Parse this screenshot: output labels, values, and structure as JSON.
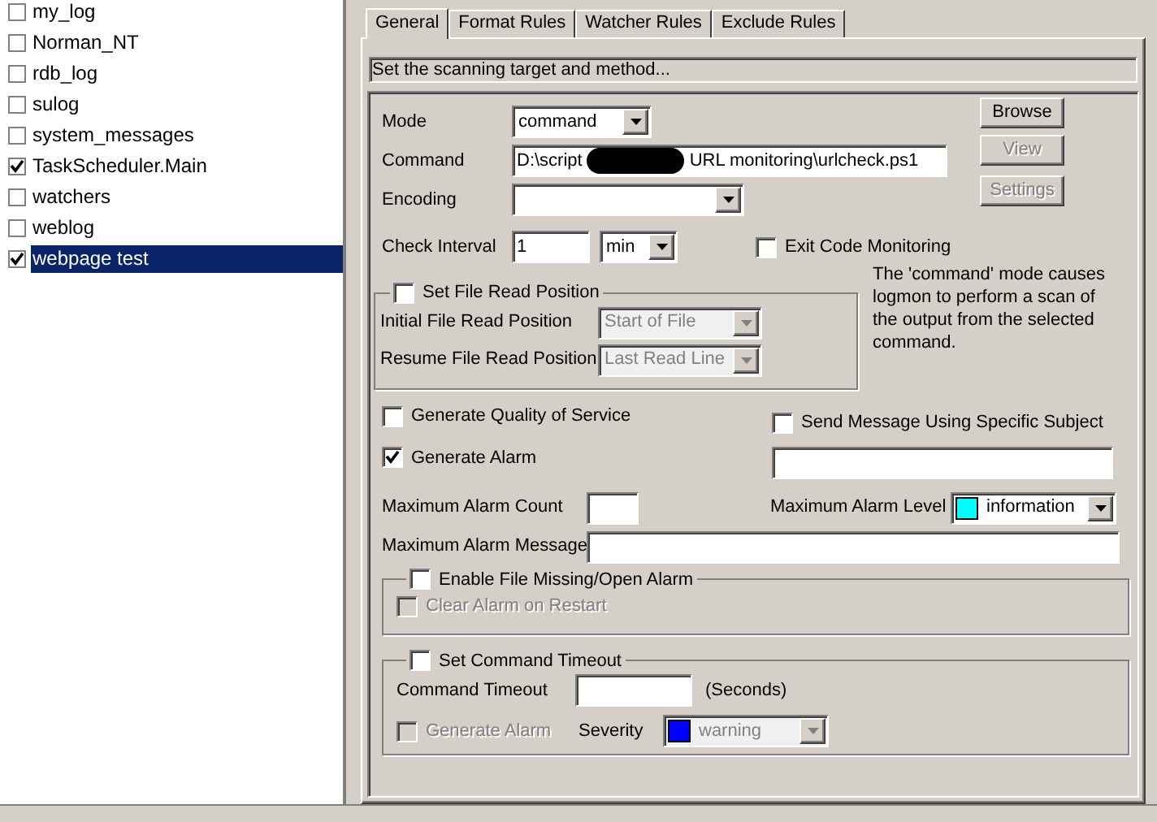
{
  "list": [
    {
      "label": "my_log",
      "checked": false,
      "selected": false
    },
    {
      "label": "Norman_NT",
      "checked": false,
      "selected": false
    },
    {
      "label": "rdb_log",
      "checked": false,
      "selected": false
    },
    {
      "label": "sulog",
      "checked": false,
      "selected": false
    },
    {
      "label": "system_messages",
      "checked": false,
      "selected": false
    },
    {
      "label": "TaskScheduler.Main",
      "checked": true,
      "selected": false
    },
    {
      "label": "watchers",
      "checked": false,
      "selected": false
    },
    {
      "label": "weblog",
      "checked": false,
      "selected": false
    },
    {
      "label": "webpage test",
      "checked": true,
      "selected": true
    }
  ],
  "tabs": [
    {
      "label": "General",
      "selected": true
    },
    {
      "label": "Format Rules",
      "selected": false
    },
    {
      "label": "Watcher Rules",
      "selected": false
    },
    {
      "label": "Exclude Rules",
      "selected": false
    }
  ],
  "hint": "Set the scanning target and method...",
  "mode": {
    "label": "Mode",
    "value": "command"
  },
  "command": {
    "label": "Command",
    "value_start": "D:\\script",
    "value_end": "URL monitoring\\urlcheck.ps1"
  },
  "encoding": {
    "label": "Encoding"
  },
  "check_interval": {
    "label": "Check Interval",
    "value": "1",
    "unit": "min"
  },
  "exit_code": {
    "label": "Exit Code Monitoring",
    "checked": false
  },
  "buttons": [
    {
      "label": "Browse",
      "disabled": false
    },
    {
      "label": "View",
      "disabled": true
    },
    {
      "label": "Settings",
      "disabled": true
    }
  ],
  "file_read": {
    "label": "Set File Read Position",
    "checked": false,
    "rows": [
      {
        "label": "Initial File Read Position",
        "value": "Start of File",
        "disabled": true
      },
      {
        "label": "Resume File Read Position",
        "value": "Last Read Line",
        "disabled": true
      }
    ]
  },
  "description": "The 'command' mode causes logmon to perform a scan of the output from the selected command.",
  "qos": {
    "label": "Generate Quality of Service",
    "checked": false
  },
  "alarm": {
    "label": "Generate Alarm",
    "checked": true
  },
  "subject": {
    "label": "Send Message Using Specific Subject",
    "checked": false
  },
  "max_alarm_count": {
    "label": "Maximum Alarm Count"
  },
  "max_alarm_level": {
    "label": "Maximum Alarm Level",
    "value": "information",
    "color": "#00ffff"
  },
  "max_alarm_message": {
    "label": "Maximum Alarm Message"
  },
  "file_missing": {
    "label": "Enable File Missing/Open Alarm",
    "checked": false,
    "clear": {
      "label": "Clear Alarm on Restart",
      "checked": false,
      "disabled": true
    }
  },
  "timeout": {
    "label": "Set Command Timeout",
    "checked": false,
    "field_label": "Command Timeout",
    "unit": "(Seconds)",
    "alarm": {
      "label": "Generate Alarm",
      "checked": false,
      "disabled": true
    },
    "severity": {
      "label": "Severity",
      "value": "warning",
      "color": "#0000ff",
      "disabled": true
    }
  }
}
